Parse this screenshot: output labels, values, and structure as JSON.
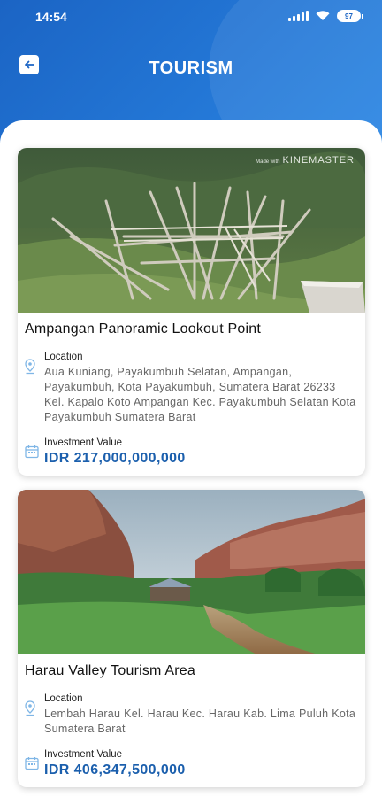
{
  "status_bar": {
    "time": "14:54",
    "battery": "97"
  },
  "header": {
    "title": "TOURISM"
  },
  "labels": {
    "location": "Location",
    "investment": "Investment Value"
  },
  "cards": [
    {
      "watermark_small": "Made with",
      "watermark": "KINEMASTER",
      "title": "Ampangan Panoramic Lookout Point",
      "location": "Aua Kuniang, Payakumbuh Selatan, Ampangan, Payakumbuh, Kota Payakumbuh, Sumatera Barat 26233 Kel. Kapalo Koto Ampangan Kec. Payakumbuh Selatan Kota Payakumbuh Sumatera Barat",
      "investment": "IDR 217,000,000,000"
    },
    {
      "title": "Harau Valley Tourism Area",
      "location": "Lembah Harau Kel. Harau Kec. Harau Kab. Lima Puluh Kota Sumatera Barat",
      "investment": "IDR 406,347,500,000"
    }
  ],
  "colors": {
    "header": "#1b64c4",
    "accent_value": "#1b5fad"
  }
}
